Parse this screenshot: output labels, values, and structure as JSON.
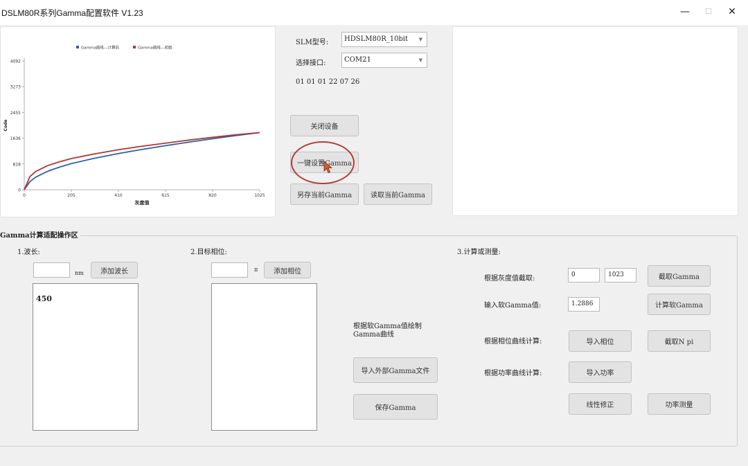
{
  "window": {
    "title": "DSLM80R系列Gamma配置软件 V1.23",
    "minimize_glyph": "—",
    "maximize_glyph": "☐",
    "close_glyph": "✕"
  },
  "top": {
    "slm_model_label": "SLM型号:",
    "slm_model_value": "HDSLM80R_10bit",
    "port_label": "选择接口:",
    "port_value": "COM21",
    "hex_readout": "01 01 01 22 07 26",
    "close_device_button": "关闭设备",
    "one_key_set_gamma_button": "一键设置Gamma",
    "save_current_gamma_button": "另存当前Gamma",
    "read_current_gamma_button": "读取当前Gamma"
  },
  "chart_data": {
    "type": "line",
    "title": "",
    "xlabel": "灰度值",
    "ylabel": "Code",
    "xlim": [
      0,
      1025
    ],
    "ylim": [
      0,
      4092
    ],
    "x_ticks": [
      "0",
      "205",
      "410",
      "615",
      "820",
      "1025"
    ],
    "y_ticks": [
      "0",
      "818",
      "1636",
      "2455",
      "3273",
      "4092"
    ],
    "legend_position": "top-center",
    "series": [
      {
        "name": "Gamma曲线---计算后",
        "color": "#2a61a6",
        "x": [
          0,
          25,
          50,
          100,
          150,
          205,
          300,
          410,
          500,
          615,
          720,
          820,
          920,
          1025
        ],
        "values": [
          0,
          260,
          400,
          580,
          710,
          830,
          990,
          1150,
          1265,
          1400,
          1515,
          1620,
          1720,
          1815
        ]
      },
      {
        "name": "Gamma曲线---初始",
        "color": "#b43434",
        "x": [
          0,
          25,
          50,
          100,
          150,
          205,
          300,
          410,
          500,
          615,
          720,
          820,
          920,
          1025
        ],
        "values": [
          0,
          420,
          580,
          760,
          880,
          990,
          1130,
          1270,
          1370,
          1480,
          1580,
          1665,
          1745,
          1815
        ]
      }
    ]
  },
  "group": {
    "title": "Gamma计算适配操作区",
    "wavelength": {
      "label": "1.波长:",
      "input_value": "",
      "unit": "nm",
      "add_button": "添加波长",
      "list_items": [
        "450"
      ]
    },
    "phase": {
      "label": "2.目标相位:",
      "input_value": "",
      "unit": "π",
      "add_button": "添加相位",
      "list_items": []
    },
    "middle": {
      "draw_curve_text": "根据软Gamma值绘制Gamma曲线",
      "import_external_button": "导入外部Gamma文件",
      "save_gamma_button": "保存Gamma"
    },
    "calc": {
      "label": "3.计算或测量:",
      "intercept_by_gray_label": "根据灰度值截取:",
      "gray_start_value": "0",
      "gray_end_value": "1023",
      "intercept_gamma_button": "截取Gamma",
      "soft_gamma_label": "输入软Gamma值:",
      "soft_gamma_value": "1.2886",
      "calc_soft_gamma_button": "计算软Gamma",
      "phase_curve_label": "根据相位曲线计算:",
      "import_phase_button": "导入相位",
      "intercept_npi_button": "截取N pi",
      "power_curve_label": "根据功率曲线计算:",
      "import_power_button": "导入功率",
      "linear_correction_button": "线性修正",
      "power_measure_button": "功率测量"
    }
  }
}
